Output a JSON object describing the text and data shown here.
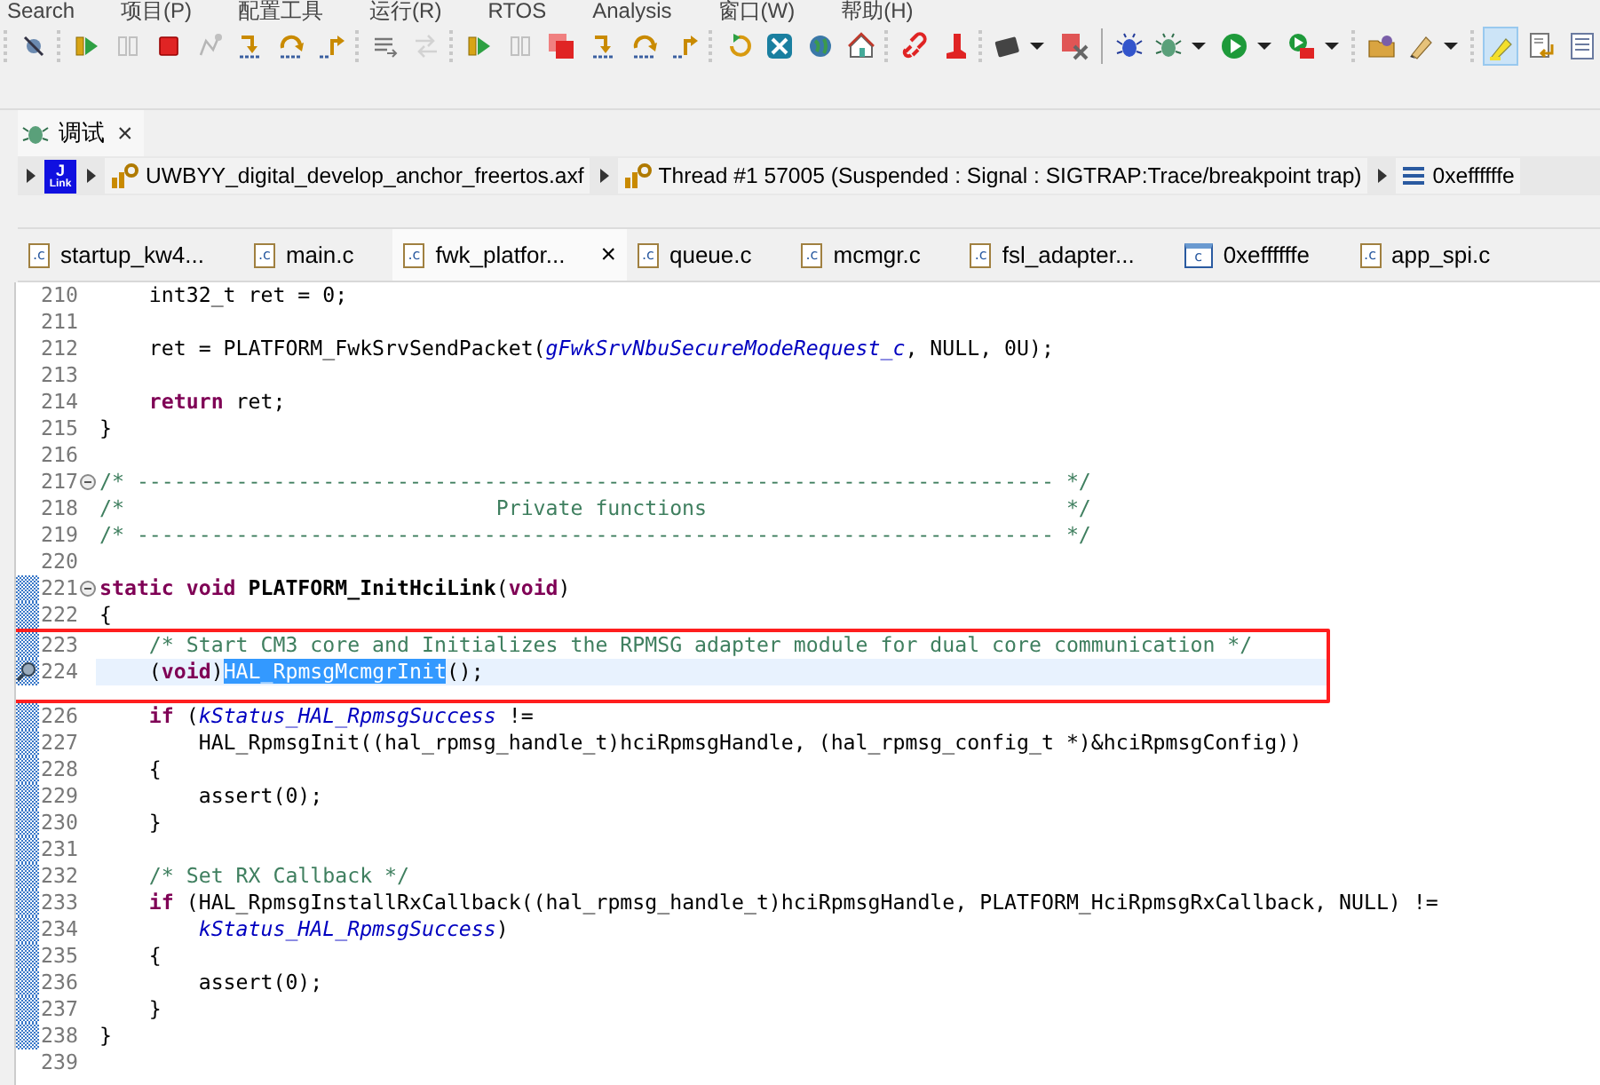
{
  "menu_bar": {
    "items": [
      "Search",
      "项目(P)",
      "配置工具",
      "运行(R)",
      "RTOS",
      "Analysis",
      "窗口(W)",
      "帮助(H)"
    ]
  },
  "toolbar": [
    {
      "kind": "separator"
    },
    {
      "kind": "skip-breakpoints",
      "disabled": false,
      "has_menu": false,
      "selected": false
    },
    {
      "kind": "separator"
    },
    {
      "kind": "resume",
      "disabled": false,
      "has_menu": false,
      "selected": false
    },
    {
      "kind": "pause",
      "disabled": true,
      "has_menu": false,
      "selected": false
    },
    {
      "kind": "stop",
      "disabled": false,
      "has_menu": false,
      "selected": false
    },
    {
      "kind": "connect",
      "disabled": true,
      "has_menu": false,
      "selected": false
    },
    {
      "kind": "step-into",
      "disabled": false,
      "has_menu": false,
      "selected": false
    },
    {
      "kind": "step-over",
      "disabled": false,
      "has_menu": false,
      "selected": false
    },
    {
      "kind": "step-return",
      "disabled": false,
      "has_menu": false,
      "selected": false
    },
    {
      "kind": "separator"
    },
    {
      "kind": "instruction-step",
      "disabled": false,
      "has_menu": false,
      "selected": false
    },
    {
      "kind": "step-filter",
      "disabled": true,
      "has_menu": false,
      "selected": false
    },
    {
      "kind": "separator"
    },
    {
      "kind": "resume",
      "disabled": false,
      "has_menu": false,
      "selected": false
    },
    {
      "kind": "pause",
      "disabled": true,
      "has_menu": false,
      "selected": false
    },
    {
      "kind": "stop-all",
      "disabled": false,
      "has_menu": false,
      "selected": false
    },
    {
      "kind": "step-into",
      "disabled": false,
      "has_menu": false,
      "selected": false
    },
    {
      "kind": "step-over",
      "disabled": false,
      "has_menu": false,
      "selected": false
    },
    {
      "kind": "step-return",
      "disabled": false,
      "has_menu": false,
      "selected": false
    },
    {
      "kind": "separator"
    },
    {
      "kind": "restart",
      "disabled": false,
      "has_menu": false,
      "selected": false
    },
    {
      "kind": "x-app",
      "disabled": false,
      "has_menu": false,
      "selected": false
    },
    {
      "kind": "globe",
      "disabled": false,
      "has_menu": false,
      "selected": false
    },
    {
      "kind": "home",
      "disabled": false,
      "has_menu": false,
      "selected": false
    },
    {
      "kind": "separator"
    },
    {
      "kind": "link",
      "disabled": false,
      "has_menu": false,
      "selected": false
    },
    {
      "kind": "boot",
      "disabled": false,
      "has_menu": false,
      "selected": false
    },
    {
      "kind": "separator"
    },
    {
      "kind": "chip",
      "disabled": false,
      "has_menu": true,
      "selected": false
    },
    {
      "kind": "chip-remove",
      "disabled": false,
      "has_menu": false,
      "selected": false
    },
    {
      "kind": "divider"
    },
    {
      "kind": "bug",
      "disabled": false,
      "has_menu": false,
      "selected": false
    },
    {
      "kind": "bug-green",
      "disabled": false,
      "has_menu": true,
      "selected": false
    },
    {
      "kind": "run",
      "disabled": false,
      "has_menu": true,
      "selected": false
    },
    {
      "kind": "run-tool",
      "disabled": false,
      "has_menu": true,
      "selected": false
    },
    {
      "kind": "separator"
    },
    {
      "kind": "folder",
      "disabled": false,
      "has_menu": false,
      "selected": false
    },
    {
      "kind": "pen",
      "disabled": false,
      "has_menu": true,
      "selected": false
    },
    {
      "kind": "separator"
    },
    {
      "kind": "highlighter",
      "disabled": false,
      "has_menu": false,
      "selected": true
    },
    {
      "kind": "doc-return",
      "disabled": false,
      "has_menu": false,
      "selected": false
    },
    {
      "kind": "list",
      "disabled": false,
      "has_menu": false,
      "selected": false
    }
  ],
  "view_tab": {
    "label": "调试",
    "close": "×"
  },
  "breadcrumb": [
    {
      "kind": "jlink",
      "logo": [
        "J",
        "Link"
      ]
    },
    {
      "kind": "program",
      "label": "UWBYY_digital_develop_anchor_freertos.axf"
    },
    {
      "kind": "thread",
      "label": "Thread #1 57005 (Suspended : Signal : SIGTRAP:Trace/breakpoint trap)"
    },
    {
      "kind": "frame",
      "label": "0xeffffffe"
    }
  ],
  "editor_tabs": [
    {
      "label": "startup_kw4...",
      "kind": "source",
      "icon_text": ".c",
      "selected": false
    },
    {
      "label": "main.c",
      "kind": "source",
      "icon_text": ".c",
      "selected": false
    },
    {
      "label": "fwk_platfor...",
      "kind": "source",
      "icon_text": ".c",
      "selected": true,
      "close": "×"
    },
    {
      "label": "queue.c",
      "kind": "source",
      "icon_text": ".c",
      "selected": false
    },
    {
      "label": "mcmgr.c",
      "kind": "source",
      "icon_text": ".c",
      "selected": false
    },
    {
      "label": "fsl_adapter...",
      "kind": "source",
      "icon_text": ".c",
      "selected": false
    },
    {
      "label": "0xeffffffe",
      "kind": "disassembly",
      "icon_text": "c",
      "selected": false
    },
    {
      "label": "app_spi.c",
      "kind": "source",
      "icon_text": ".c",
      "selected": false
    }
  ],
  "code_lines": [
    {
      "number": "210",
      "tokens": [
        {
          "kind": "text",
          "text": "    int32_t ret = 0;"
        }
      ]
    },
    {
      "number": "211"
    },
    {
      "number": "212",
      "tokens": [
        {
          "kind": "text",
          "text": "    ret = PLATFORM_FwkSrvSendPacket("
        },
        {
          "kind": "constant",
          "text": "gFwkSrvNbuSecureModeRequest_c"
        },
        {
          "kind": "text",
          "text": ", NULL, 0U);"
        }
      ]
    },
    {
      "number": "213"
    },
    {
      "number": "214",
      "tokens": [
        {
          "kind": "keyword",
          "text": "    return"
        },
        {
          "kind": "text",
          "text": " ret;"
        }
      ]
    },
    {
      "number": "215",
      "tokens": [
        {
          "kind": "text",
          "text": "}"
        }
      ]
    },
    {
      "number": "216"
    },
    {
      "number": "217",
      "fold": true,
      "tokens": [
        {
          "kind": "comment",
          "text": "/* -------------------------------------------------------------------------- */"
        }
      ]
    },
    {
      "number": "218",
      "tokens": [
        {
          "kind": "comment",
          "text": "/*                              Private functions                             */"
        }
      ]
    },
    {
      "number": "219",
      "tokens": [
        {
          "kind": "comment",
          "text": "/* -------------------------------------------------------------------------- */"
        }
      ]
    },
    {
      "number": "220"
    },
    {
      "number": "221",
      "fold": true,
      "marked": true,
      "tokens": [
        {
          "kind": "keyword",
          "text": "static void"
        },
        {
          "kind": "declaration",
          "text": " PLATFORM_InitHciLink"
        },
        {
          "kind": "text",
          "text": "("
        },
        {
          "kind": "keyword",
          "text": "void"
        },
        {
          "kind": "text",
          "text": ")"
        }
      ]
    },
    {
      "number": "222",
      "marked": true,
      "tokens": [
        {
          "kind": "text",
          "text": "{"
        }
      ]
    },
    {
      "number": "223",
      "marked": true,
      "boxed": true,
      "tokens": [
        {
          "kind": "comment",
          "text": "    /* Start CM3 core and Initializes the RPMSG adapter module for dual core communication */"
        }
      ]
    },
    {
      "number": "224",
      "marked": true,
      "boxed": true,
      "current": true,
      "pointer": true,
      "tokens": [
        {
          "kind": "text",
          "text": "    ("
        },
        {
          "kind": "keyword",
          "text": "void"
        },
        {
          "kind": "text",
          "text": ")"
        },
        {
          "kind": "selection",
          "text": "HAL_RpmsgMcmgrInit"
        },
        {
          "kind": "text",
          "text": "();"
        }
      ]
    },
    {
      "number": "226",
      "marked": true,
      "tokens": [
        {
          "kind": "keyword",
          "text": "    if"
        },
        {
          "kind": "text",
          "text": " ("
        },
        {
          "kind": "constant",
          "text": "kStatus_HAL_RpmsgSuccess"
        },
        {
          "kind": "text",
          "text": " !="
        }
      ]
    },
    {
      "number": "227",
      "marked": true,
      "tokens": [
        {
          "kind": "text",
          "text": "        HAL_RpmsgInit((hal_rpmsg_handle_t)hciRpmsgHandle, (hal_rpmsg_config_t *)&hciRpmsgConfig))"
        }
      ]
    },
    {
      "number": "228",
      "marked": true,
      "tokens": [
        {
          "kind": "text",
          "text": "    {"
        }
      ]
    },
    {
      "number": "229",
      "marked": true,
      "tokens": [
        {
          "kind": "text",
          "text": "        assert(0);"
        }
      ]
    },
    {
      "number": "230",
      "marked": true,
      "tokens": [
        {
          "kind": "text",
          "text": "    }"
        }
      ]
    },
    {
      "number": "231",
      "marked": true
    },
    {
      "number": "232",
      "marked": true,
      "tokens": [
        {
          "kind": "comment",
          "text": "    /* Set RX Callback */"
        }
      ]
    },
    {
      "number": "233",
      "marked": true,
      "tokens": [
        {
          "kind": "keyword",
          "text": "    if"
        },
        {
          "kind": "text",
          "text": " (HAL_RpmsgInstallRxCallback((hal_rpmsg_handle_t)hciRpmsgHandle, PLATFORM_HciRpmsgRxCallback, NULL) !="
        }
      ]
    },
    {
      "number": "234",
      "marked": true,
      "tokens": [
        {
          "kind": "constant",
          "text": "        kStatus_HAL_RpmsgSuccess"
        },
        {
          "kind": "text",
          "text": ")"
        }
      ]
    },
    {
      "number": "235",
      "marked": true,
      "tokens": [
        {
          "kind": "text",
          "text": "    {"
        }
      ]
    },
    {
      "number": "236",
      "marked": true,
      "tokens": [
        {
          "kind": "text",
          "text": "        assert(0);"
        }
      ]
    },
    {
      "number": "237",
      "marked": true,
      "tokens": [
        {
          "kind": "text",
          "text": "    }"
        }
      ]
    },
    {
      "number": "238",
      "marked": true,
      "tokens": [
        {
          "kind": "text",
          "text": "}"
        }
      ]
    },
    {
      "number": "239"
    }
  ]
}
